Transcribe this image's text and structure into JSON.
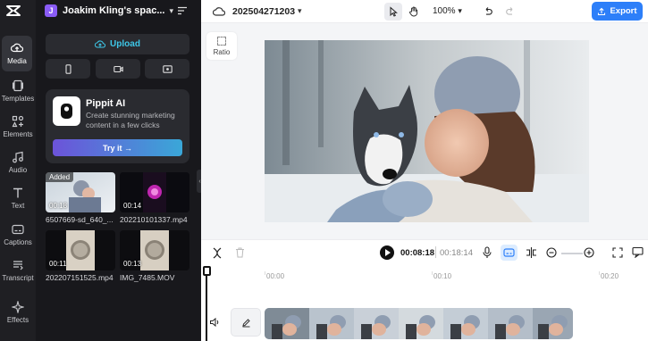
{
  "rail": {
    "items": [
      {
        "label": "Media",
        "icon": "cloud-upload-icon",
        "active": true
      },
      {
        "label": "Templates",
        "icon": "templates-icon"
      },
      {
        "label": "Elements",
        "icon": "elements-icon"
      },
      {
        "label": "Audio",
        "icon": "music-note-icon"
      },
      {
        "label": "Text",
        "icon": "text-icon"
      },
      {
        "label": "Captions",
        "icon": "captions-icon"
      },
      {
        "label": "Transcript",
        "icon": "transcript-icon"
      },
      {
        "label": "Effects",
        "icon": "effects-icon"
      }
    ]
  },
  "workspace": {
    "avatar": "J",
    "name": "Joakim Kling's spac..."
  },
  "panel": {
    "upload_label": "Upload",
    "promo": {
      "title": "Pippit AI",
      "description": "Create stunning marketing content in a few clicks",
      "cta": "Try it →"
    },
    "media": [
      {
        "name": "6507669-sd_640_...",
        "duration": "00:18",
        "added": "Added"
      },
      {
        "name": "202210101337.mp4",
        "duration": "00:14"
      },
      {
        "name": "202207151525.mp4",
        "duration": "00:11"
      },
      {
        "name": "IMG_7485.MOV",
        "duration": "00:13"
      }
    ]
  },
  "topbar": {
    "project_name": "202504271203",
    "zoom": "100%",
    "export_label": "Export"
  },
  "stage": {
    "ratio_label": "Ratio"
  },
  "controls": {
    "current_time": "00:08:18",
    "total_time": "00:18:14"
  },
  "timeline": {
    "ruler": [
      "00:00",
      "00:10",
      "00:20"
    ],
    "playhead_fraction": 0.45
  },
  "colors": {
    "accent": "#2d7ff9",
    "upload": "#3ec7e8",
    "rail_bg": "#1f1f23",
    "panel_bg": "#18181c"
  }
}
